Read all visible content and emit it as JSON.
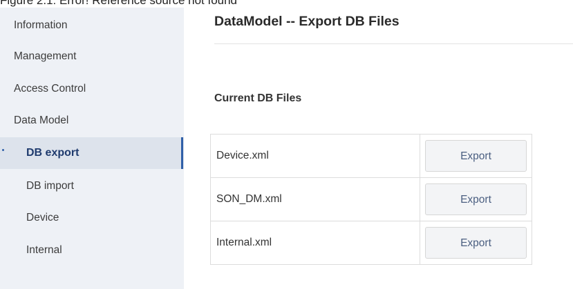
{
  "caption": "Figure 2.1: Error! Reference source not found",
  "sidebar": {
    "items": [
      {
        "label": "Information",
        "name": "sidebar-item-information"
      },
      {
        "label": "Management",
        "name": "sidebar-item-management"
      },
      {
        "label": "Access Control",
        "name": "sidebar-item-access-control"
      },
      {
        "label": "Data Model",
        "name": "sidebar-item-data-model"
      },
      {
        "label": "DB export",
        "name": "sidebar-item-db-export",
        "active": true
      },
      {
        "label": "DB import",
        "name": "sidebar-item-db-import"
      },
      {
        "label": "Device",
        "name": "sidebar-item-device"
      },
      {
        "label": "Internal",
        "name": "sidebar-item-internal"
      }
    ]
  },
  "main": {
    "title": "DataModel -- Export DB Files",
    "section_title": "Current DB Files",
    "files": [
      {
        "name": "Device.xml",
        "action": "Export"
      },
      {
        "name": "SON_DM.xml",
        "action": "Export"
      },
      {
        "name": "Internal.xml",
        "action": "Export"
      }
    ]
  },
  "colors": {
    "sidebar_bg": "#eef1f6",
    "active_bg": "#dde3ec",
    "accent": "#2f5fa8",
    "button_text": "#4a5e80"
  }
}
